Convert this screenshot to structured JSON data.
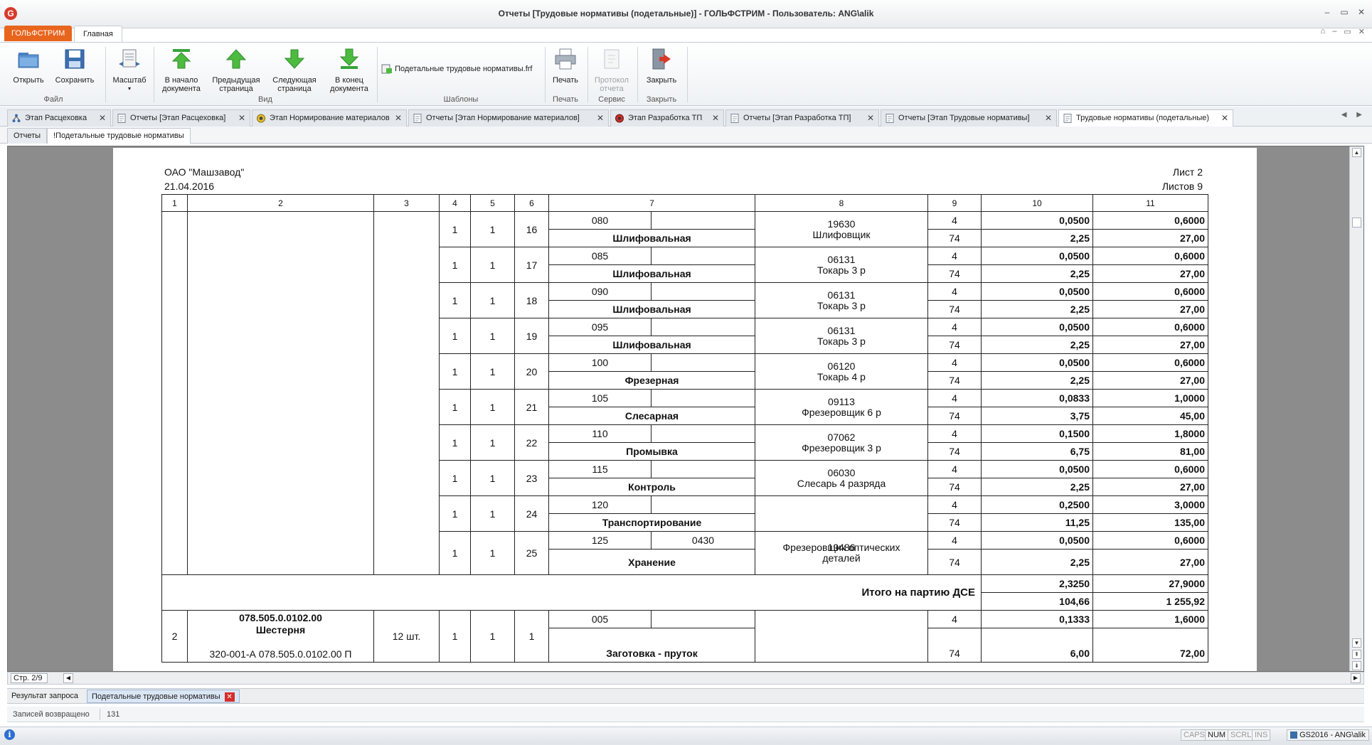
{
  "window": {
    "logo": "G",
    "title": "Отчеты  [Трудовые нормативы (подетальные)] - ГОЛЬФСТРИМ - Пользователь: ANG\\alik"
  },
  "ribbon_tabs": {
    "app": "ГОЛЬФСТРИМ",
    "main": "Главная"
  },
  "ribbon": {
    "open": "Открыть",
    "save": "Сохранить",
    "group_file": "Файл",
    "scale": "Масштаб",
    "first_line1": "В начало",
    "first_line2": "документа",
    "prev_line1": "Предыдущая",
    "prev_line2": "страница",
    "next_line1": "Следующая",
    "next_line2": "страница",
    "last_line1": "В конец",
    "last_line2": "документа",
    "group_view": "Вид",
    "template_file": "Подетальные трудовые нормативы.frf",
    "group_templates": "Шаблоны",
    "print": "Печать",
    "group_print": "Печать",
    "protocol_line1": "Протокол",
    "protocol_line2": "отчета",
    "group_service": "Сервис",
    "close": "Закрыть",
    "group_close": "Закрыть"
  },
  "doc_tabs": [
    {
      "label": "Этап Расцеховка",
      "icon": "tree-icon"
    },
    {
      "label": "Отчеты  [Этап Расцеховка]",
      "icon": "document-icon"
    },
    {
      "label": "Этап Нормирование материалов",
      "icon": "coins-icon"
    },
    {
      "label": "Отчеты  [Этап Нормирование материалов]",
      "icon": "document-icon"
    },
    {
      "label": "Этап Разработка ТП",
      "icon": "gear-icon"
    },
    {
      "label": "Отчеты  [Этап Разработка ТП]",
      "icon": "document-icon"
    },
    {
      "label": "Отчеты  [Этап Трудовые нормативы]",
      "icon": "document-icon"
    },
    {
      "label": "Трудовые нормативы (подетальные)",
      "icon": "document-icon"
    }
  ],
  "sub_tabs": {
    "reports": "Отчеты",
    "current": "!Подетальные трудовые нормативы"
  },
  "report": {
    "org": "ОАО \"Машзавод\"",
    "date": "21.04.2016",
    "sheet": "Лист 2",
    "sheets": "Листов 9",
    "col_headers": [
      "1",
      "2",
      "3",
      "4",
      "5",
      "6",
      "7",
      "8",
      "9",
      "10",
      "11"
    ],
    "ops": [
      {
        "c4": "1",
        "c5": "1",
        "c6": "16",
        "code": "080",
        "extra": "",
        "name": "Шлифовальная",
        "prof_code": "19630",
        "prof_name": "Шлифовщик",
        "c9a": "4",
        "c9b": "74",
        "c10a": "0,0500",
        "c10b": "2,25",
        "c11a": "0,6000",
        "c11b": "27,00"
      },
      {
        "c4": "1",
        "c5": "1",
        "c6": "17",
        "code": "085",
        "extra": "",
        "name": "Шлифовальная",
        "prof_code": "06131",
        "prof_name": "Токарь 3 р",
        "c9a": "4",
        "c9b": "74",
        "c10a": "0,0500",
        "c10b": "2,25",
        "c11a": "0,6000",
        "c11b": "27,00"
      },
      {
        "c4": "1",
        "c5": "1",
        "c6": "18",
        "code": "090",
        "extra": "",
        "name": "Шлифовальная",
        "prof_code": "06131",
        "prof_name": "Токарь 3 р",
        "c9a": "4",
        "c9b": "74",
        "c10a": "0,0500",
        "c10b": "2,25",
        "c11a": "0,6000",
        "c11b": "27,00"
      },
      {
        "c4": "1",
        "c5": "1",
        "c6": "19",
        "code": "095",
        "extra": "",
        "name": "Шлифовальная",
        "prof_code": "06131",
        "prof_name": "Токарь 3 р",
        "c9a": "4",
        "c9b": "74",
        "c10a": "0,0500",
        "c10b": "2,25",
        "c11a": "0,6000",
        "c11b": "27,00"
      },
      {
        "c4": "1",
        "c5": "1",
        "c6": "20",
        "code": "100",
        "extra": "",
        "name": "Фрезерная",
        "prof_code": "06120",
        "prof_name": "Токарь 4 р",
        "c9a": "4",
        "c9b": "74",
        "c10a": "0,0500",
        "c10b": "2,25",
        "c11a": "0,6000",
        "c11b": "27,00"
      },
      {
        "c4": "1",
        "c5": "1",
        "c6": "21",
        "code": "105",
        "extra": "",
        "name": "Слесарная",
        "prof_code": "09113",
        "prof_name": "Фрезеровщик 6 р",
        "c9a": "4",
        "c9b": "74",
        "c10a": "0,0833",
        "c10b": "3,75",
        "c11a": "1,0000",
        "c11b": "45,00"
      },
      {
        "c4": "1",
        "c5": "1",
        "c6": "22",
        "code": "110",
        "extra": "",
        "name": "Промывка",
        "prof_code": "07062",
        "prof_name": "Фрезеровщик 3 р",
        "c9a": "4",
        "c9b": "74",
        "c10a": "0,1500",
        "c10b": "6,75",
        "c11a": "1,8000",
        "c11b": "81,00"
      },
      {
        "c4": "1",
        "c5": "1",
        "c6": "23",
        "code": "115",
        "extra": "",
        "name": "Контроль",
        "prof_code": "06030",
        "prof_name": "Слесарь 4 разряда",
        "c9a": "4",
        "c9b": "74",
        "c10a": "0,0500",
        "c10b": "2,25",
        "c11a": "0,6000",
        "c11b": "27,00"
      },
      {
        "c4": "1",
        "c5": "1",
        "c6": "24",
        "code": "120",
        "extra": "",
        "name": "Транспортирование",
        "prof_code": "",
        "prof_name": "",
        "c9a": "4",
        "c9b": "74",
        "c10a": "0,2500",
        "c10b": "11,25",
        "c11a": "3,0000",
        "c11b": "135,00"
      },
      {
        "c4": "1",
        "c5": "1",
        "c6": "25",
        "code": "125",
        "extra": "0430",
        "name": "Хранение",
        "prof_code": "19486",
        "prof_name": "Фрезеровщик оптических деталей",
        "c9a": "4",
        "c9b": "74",
        "c10a": "0,0500",
        "c10b": "2,25",
        "c11a": "0,6000",
        "c11b": "27,00"
      }
    ],
    "total": {
      "label": "Итого на партию ДСЕ",
      "c10a": "2,3250",
      "c10b": "104,66",
      "c11a": "27,9000",
      "c11b": "1 255,92"
    },
    "part2": {
      "c1": "2",
      "code": "078.505.0.0102.00",
      "name": "Шестерня",
      "route": "320-001-А 078.505.0.0102.00 П",
      "qty": "12 шт.",
      "c4": "1",
      "c5": "1",
      "c6": "1",
      "op_code": "005",
      "op_name": "Заготовка - пруток",
      "c9a": "4",
      "c9b": "74",
      "c10a": "0,1333",
      "c10b": "6,00",
      "c11a": "1,6000",
      "c11b": "72,00"
    }
  },
  "pager": {
    "page": "Стр. 2/9"
  },
  "bottom_tabs": {
    "query_result": "Результат запроса",
    "current": "Подетальные трудовые нормативы"
  },
  "records": {
    "label": "Записей возвращено",
    "value": "131"
  },
  "status": {
    "caps": "CAPS",
    "num": "NUM",
    "scrl": "SCRL",
    "ins": "INS",
    "user": "GS2016 - ANG\\alik"
  }
}
